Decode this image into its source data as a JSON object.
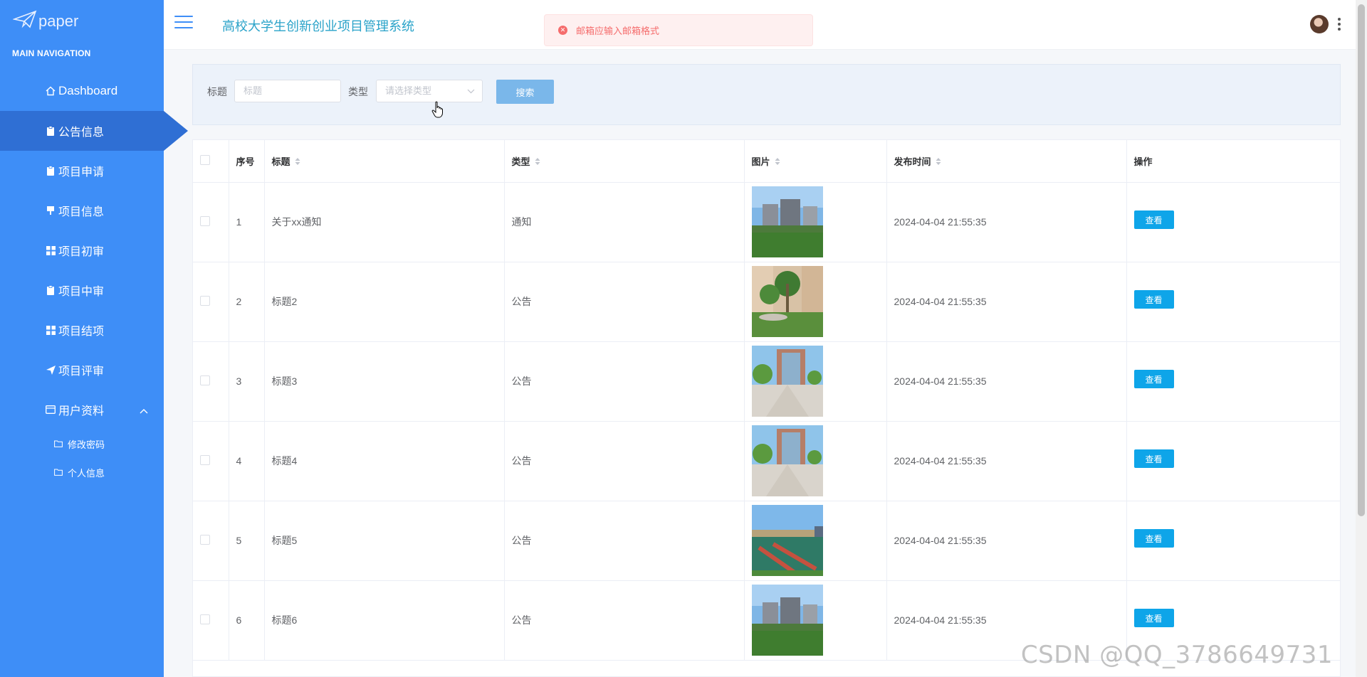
{
  "app": {
    "logo_text": "paper",
    "system_title": "高校大学生创新创业项目管理系统"
  },
  "sidebar": {
    "section_title": "MAIN NAVIGATION",
    "items": [
      {
        "label": "Dashboard",
        "icon": "home-icon"
      },
      {
        "label": "公告信息",
        "icon": "clipboard-icon",
        "active": true
      },
      {
        "label": "项目申请",
        "icon": "clipboard-icon"
      },
      {
        "label": "项目信息",
        "icon": "flag-icon"
      },
      {
        "label": "项目初审",
        "icon": "grid-icon"
      },
      {
        "label": "项目中审",
        "icon": "clipboard-icon"
      },
      {
        "label": "项目结项",
        "icon": "grid-icon"
      },
      {
        "label": "项目评审",
        "icon": "send-icon"
      },
      {
        "label": "用户资料",
        "icon": "id-card-icon",
        "expanded": true
      }
    ],
    "sub_items": [
      {
        "label": "修改密码",
        "icon": "folder-icon"
      },
      {
        "label": "个人信息",
        "icon": "folder-icon"
      }
    ]
  },
  "toast": {
    "message": "邮箱应输入邮箱格式",
    "type": "error",
    "color": "#f56c6c"
  },
  "search": {
    "title_label": "标题",
    "title_placeholder": "标题",
    "type_label": "类型",
    "type_placeholder": "请选择类型",
    "button_label": "搜索"
  },
  "table": {
    "headers": {
      "index": "序号",
      "title": "标题",
      "type": "类型",
      "image": "图片",
      "time": "发布时间",
      "action": "操作"
    },
    "rows": [
      {
        "index": "1",
        "title": "关于xx通知",
        "type": "通知",
        "time": "2024-04-04 21:55:35",
        "action": "查看",
        "image": "campus-building-lawn"
      },
      {
        "index": "2",
        "title": "标题2",
        "type": "公告",
        "time": "2024-04-04 21:55:35",
        "action": "查看",
        "image": "campus-palm-garden"
      },
      {
        "index": "3",
        "title": "标题3",
        "type": "公告",
        "time": "2024-04-04 21:55:35",
        "action": "查看",
        "image": "campus-building-plaza"
      },
      {
        "index": "4",
        "title": "标题4",
        "type": "公告",
        "time": "2024-04-04 21:55:35",
        "action": "查看",
        "image": "campus-building-plaza"
      },
      {
        "index": "5",
        "title": "标题5",
        "type": "公告",
        "time": "2024-04-04 21:55:35",
        "action": "查看",
        "image": "sports-court"
      },
      {
        "index": "6",
        "title": "标题6",
        "type": "公告",
        "time": "2024-04-04 21:55:35",
        "action": "查看",
        "image": "campus-building-lawn"
      }
    ]
  },
  "watermark": "CSDN @QQ_3786649731",
  "colors": {
    "sidebar": "#3e8ef7",
    "sidebar_active": "#2f6fd4",
    "title": "#2aa3c9",
    "view_button": "#0ea5e9"
  }
}
